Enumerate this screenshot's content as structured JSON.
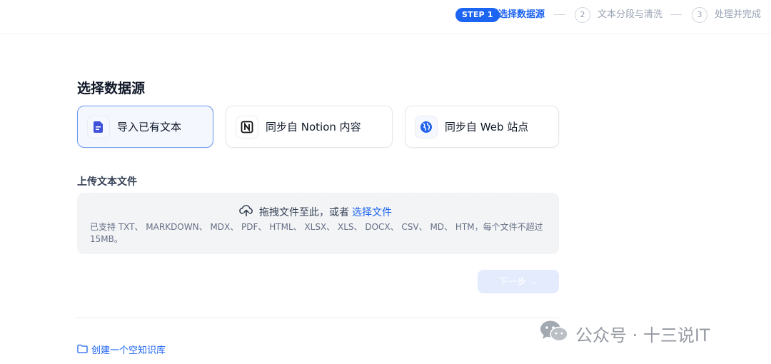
{
  "stepper": {
    "step1_badge": "STEP 1",
    "step1_label": "选择数据源",
    "step2_number": "2",
    "step2_label": "文本分段与清洗",
    "step3_number": "3",
    "step3_label": "处理并完成"
  },
  "page_title": "选择数据源",
  "sources": [
    {
      "label": "导入已有文本",
      "icon": "document-icon",
      "selected": true
    },
    {
      "label": "同步自 Notion 内容",
      "icon": "notion-icon",
      "selected": false
    },
    {
      "label": "同步自 Web 站点",
      "icon": "web-icon",
      "selected": false
    }
  ],
  "upload": {
    "section_label": "上传文本文件",
    "drop_text": "拖拽文件至此，或者",
    "select_link": "选择文件",
    "hint": "已支持 TXT、 MARKDOWN、 MDX、 PDF、 HTML、 XLSX、 XLS、 DOCX、 CSV、 MD、 HTM，每个文件不超过 15MB。"
  },
  "next_button": "下一步 →",
  "create_empty": "创建一个空知识库",
  "watermark": "公众号 · 十三说IT",
  "colors": {
    "accent": "#1c64f2",
    "disabled_button": "#e3ebfd",
    "dropzone_bg": "#f3f4f6"
  }
}
